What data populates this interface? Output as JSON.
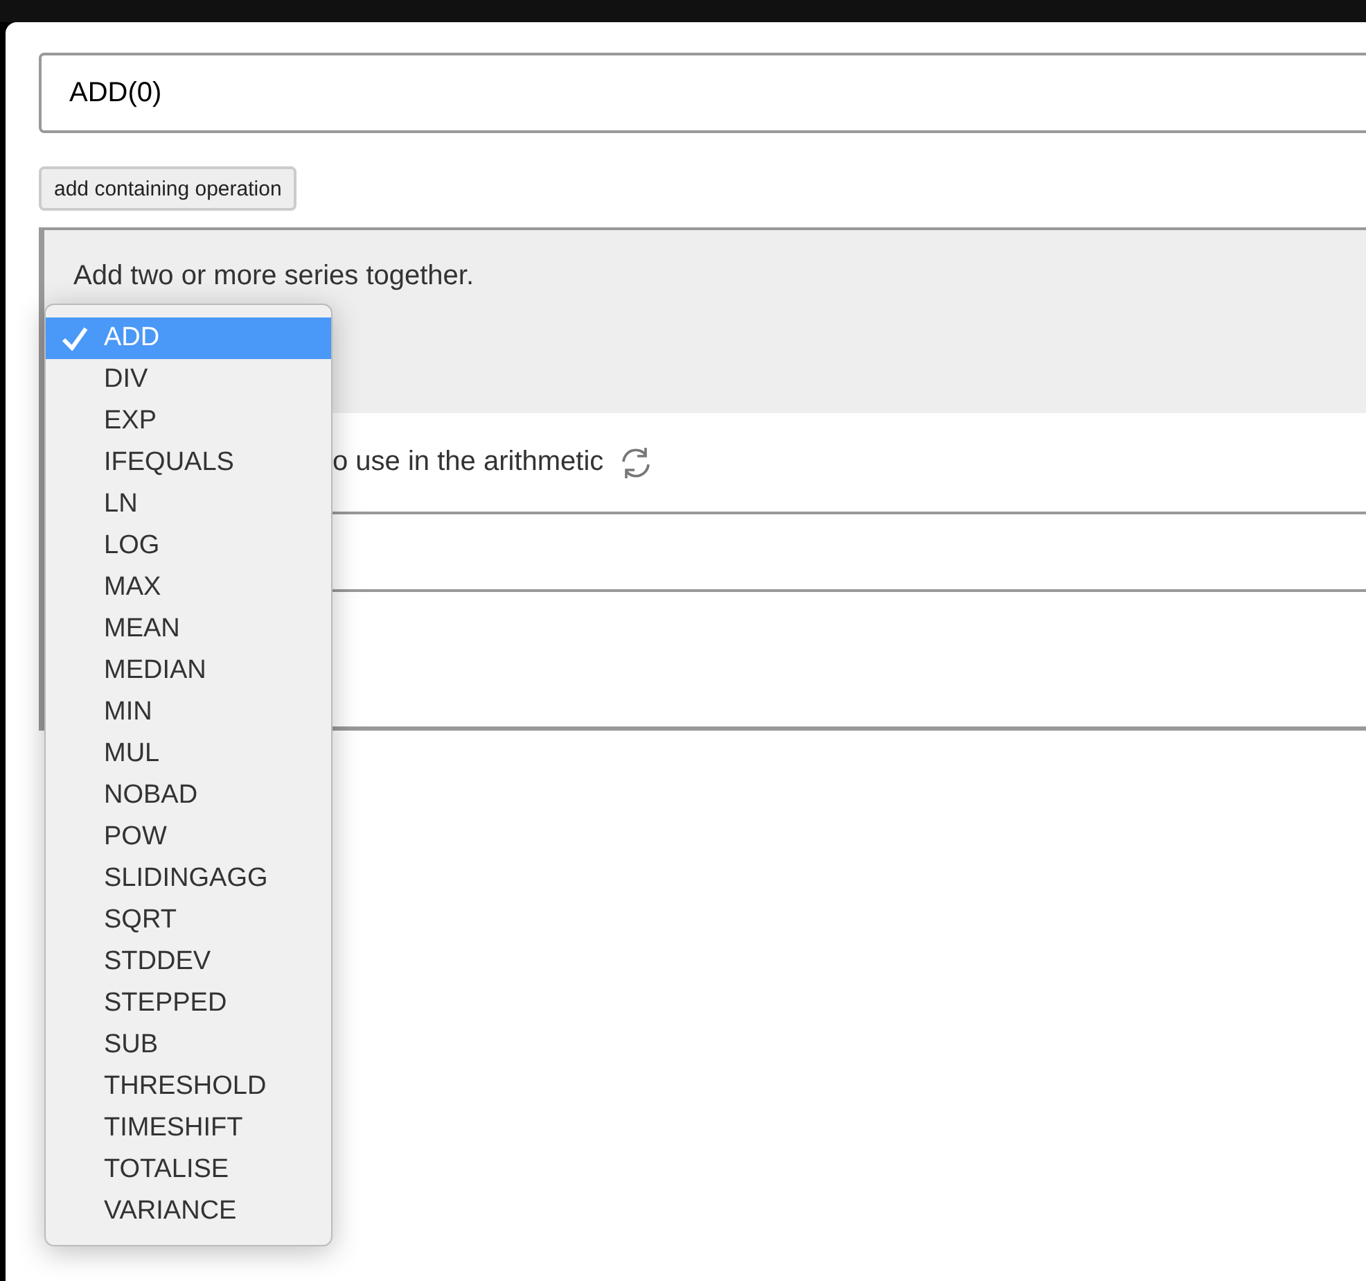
{
  "expression_field": {
    "value": "ADD(0)"
  },
  "add_button": {
    "label": "add containing operation"
  },
  "description": "Add two or more series together.",
  "parameter_label": "o use in the arithmetic",
  "operation_menu": {
    "items": [
      {
        "label": "ADD",
        "selected": true
      },
      {
        "label": "DIV",
        "selected": false
      },
      {
        "label": "EXP",
        "selected": false
      },
      {
        "label": "IFEQUALS",
        "selected": false
      },
      {
        "label": "LN",
        "selected": false
      },
      {
        "label": "LOG",
        "selected": false
      },
      {
        "label": "MAX",
        "selected": false
      },
      {
        "label": "MEAN",
        "selected": false
      },
      {
        "label": "MEDIAN",
        "selected": false
      },
      {
        "label": "MIN",
        "selected": false
      },
      {
        "label": "MUL",
        "selected": false
      },
      {
        "label": "NOBAD",
        "selected": false
      },
      {
        "label": "POW",
        "selected": false
      },
      {
        "label": "SLIDINGAGG",
        "selected": false
      },
      {
        "label": "SQRT",
        "selected": false
      },
      {
        "label": "STDDEV",
        "selected": false
      },
      {
        "label": "STEPPED",
        "selected": false
      },
      {
        "label": "SUB",
        "selected": false
      },
      {
        "label": "THRESHOLD",
        "selected": false
      },
      {
        "label": "TIMESHIFT",
        "selected": false
      },
      {
        "label": "TOTALISE",
        "selected": false
      },
      {
        "label": "VARIANCE",
        "selected": false
      }
    ]
  }
}
